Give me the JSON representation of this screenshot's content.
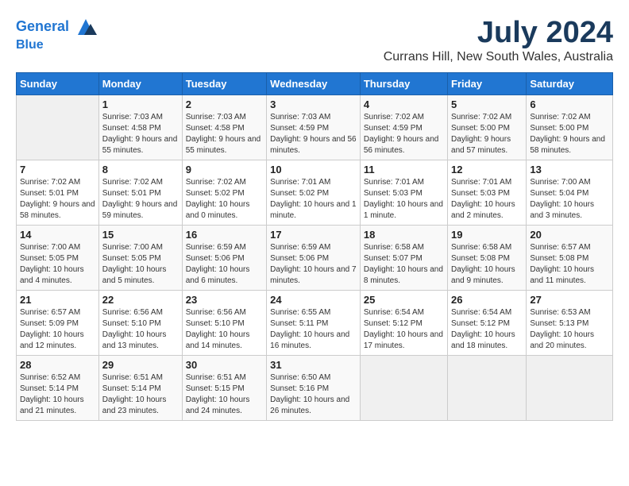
{
  "header": {
    "logo_line1": "General",
    "logo_line2": "Blue",
    "month_year": "July 2024",
    "location": "Currans Hill, New South Wales, Australia"
  },
  "days_of_week": [
    "Sunday",
    "Monday",
    "Tuesday",
    "Wednesday",
    "Thursday",
    "Friday",
    "Saturday"
  ],
  "weeks": [
    [
      {
        "day": "",
        "sunrise": "",
        "sunset": "",
        "daylight": ""
      },
      {
        "day": "1",
        "sunrise": "Sunrise: 7:03 AM",
        "sunset": "Sunset: 4:58 PM",
        "daylight": "Daylight: 9 hours and 55 minutes."
      },
      {
        "day": "2",
        "sunrise": "Sunrise: 7:03 AM",
        "sunset": "Sunset: 4:58 PM",
        "daylight": "Daylight: 9 hours and 55 minutes."
      },
      {
        "day": "3",
        "sunrise": "Sunrise: 7:03 AM",
        "sunset": "Sunset: 4:59 PM",
        "daylight": "Daylight: 9 hours and 56 minutes."
      },
      {
        "day": "4",
        "sunrise": "Sunrise: 7:02 AM",
        "sunset": "Sunset: 4:59 PM",
        "daylight": "Daylight: 9 hours and 56 minutes."
      },
      {
        "day": "5",
        "sunrise": "Sunrise: 7:02 AM",
        "sunset": "Sunset: 5:00 PM",
        "daylight": "Daylight: 9 hours and 57 minutes."
      },
      {
        "day": "6",
        "sunrise": "Sunrise: 7:02 AM",
        "sunset": "Sunset: 5:00 PM",
        "daylight": "Daylight: 9 hours and 58 minutes."
      }
    ],
    [
      {
        "day": "7",
        "sunrise": "Sunrise: 7:02 AM",
        "sunset": "Sunset: 5:01 PM",
        "daylight": "Daylight: 9 hours and 58 minutes."
      },
      {
        "day": "8",
        "sunrise": "Sunrise: 7:02 AM",
        "sunset": "Sunset: 5:01 PM",
        "daylight": "Daylight: 9 hours and 59 minutes."
      },
      {
        "day": "9",
        "sunrise": "Sunrise: 7:02 AM",
        "sunset": "Sunset: 5:02 PM",
        "daylight": "Daylight: 10 hours and 0 minutes."
      },
      {
        "day": "10",
        "sunrise": "Sunrise: 7:01 AM",
        "sunset": "Sunset: 5:02 PM",
        "daylight": "Daylight: 10 hours and 1 minute."
      },
      {
        "day": "11",
        "sunrise": "Sunrise: 7:01 AM",
        "sunset": "Sunset: 5:03 PM",
        "daylight": "Daylight: 10 hours and 1 minute."
      },
      {
        "day": "12",
        "sunrise": "Sunrise: 7:01 AM",
        "sunset": "Sunset: 5:03 PM",
        "daylight": "Daylight: 10 hours and 2 minutes."
      },
      {
        "day": "13",
        "sunrise": "Sunrise: 7:00 AM",
        "sunset": "Sunset: 5:04 PM",
        "daylight": "Daylight: 10 hours and 3 minutes."
      }
    ],
    [
      {
        "day": "14",
        "sunrise": "Sunrise: 7:00 AM",
        "sunset": "Sunset: 5:05 PM",
        "daylight": "Daylight: 10 hours and 4 minutes."
      },
      {
        "day": "15",
        "sunrise": "Sunrise: 7:00 AM",
        "sunset": "Sunset: 5:05 PM",
        "daylight": "Daylight: 10 hours and 5 minutes."
      },
      {
        "day": "16",
        "sunrise": "Sunrise: 6:59 AM",
        "sunset": "Sunset: 5:06 PM",
        "daylight": "Daylight: 10 hours and 6 minutes."
      },
      {
        "day": "17",
        "sunrise": "Sunrise: 6:59 AM",
        "sunset": "Sunset: 5:06 PM",
        "daylight": "Daylight: 10 hours and 7 minutes."
      },
      {
        "day": "18",
        "sunrise": "Sunrise: 6:58 AM",
        "sunset": "Sunset: 5:07 PM",
        "daylight": "Daylight: 10 hours and 8 minutes."
      },
      {
        "day": "19",
        "sunrise": "Sunrise: 6:58 AM",
        "sunset": "Sunset: 5:08 PM",
        "daylight": "Daylight: 10 hours and 9 minutes."
      },
      {
        "day": "20",
        "sunrise": "Sunrise: 6:57 AM",
        "sunset": "Sunset: 5:08 PM",
        "daylight": "Daylight: 10 hours and 11 minutes."
      }
    ],
    [
      {
        "day": "21",
        "sunrise": "Sunrise: 6:57 AM",
        "sunset": "Sunset: 5:09 PM",
        "daylight": "Daylight: 10 hours and 12 minutes."
      },
      {
        "day": "22",
        "sunrise": "Sunrise: 6:56 AM",
        "sunset": "Sunset: 5:10 PM",
        "daylight": "Daylight: 10 hours and 13 minutes."
      },
      {
        "day": "23",
        "sunrise": "Sunrise: 6:56 AM",
        "sunset": "Sunset: 5:10 PM",
        "daylight": "Daylight: 10 hours and 14 minutes."
      },
      {
        "day": "24",
        "sunrise": "Sunrise: 6:55 AM",
        "sunset": "Sunset: 5:11 PM",
        "daylight": "Daylight: 10 hours and 16 minutes."
      },
      {
        "day": "25",
        "sunrise": "Sunrise: 6:54 AM",
        "sunset": "Sunset: 5:12 PM",
        "daylight": "Daylight: 10 hours and 17 minutes."
      },
      {
        "day": "26",
        "sunrise": "Sunrise: 6:54 AM",
        "sunset": "Sunset: 5:12 PM",
        "daylight": "Daylight: 10 hours and 18 minutes."
      },
      {
        "day": "27",
        "sunrise": "Sunrise: 6:53 AM",
        "sunset": "Sunset: 5:13 PM",
        "daylight": "Daylight: 10 hours and 20 minutes."
      }
    ],
    [
      {
        "day": "28",
        "sunrise": "Sunrise: 6:52 AM",
        "sunset": "Sunset: 5:14 PM",
        "daylight": "Daylight: 10 hours and 21 minutes."
      },
      {
        "day": "29",
        "sunrise": "Sunrise: 6:51 AM",
        "sunset": "Sunset: 5:14 PM",
        "daylight": "Daylight: 10 hours and 23 minutes."
      },
      {
        "day": "30",
        "sunrise": "Sunrise: 6:51 AM",
        "sunset": "Sunset: 5:15 PM",
        "daylight": "Daylight: 10 hours and 24 minutes."
      },
      {
        "day": "31",
        "sunrise": "Sunrise: 6:50 AM",
        "sunset": "Sunset: 5:16 PM",
        "daylight": "Daylight: 10 hours and 26 minutes."
      },
      {
        "day": "",
        "sunrise": "",
        "sunset": "",
        "daylight": ""
      },
      {
        "day": "",
        "sunrise": "",
        "sunset": "",
        "daylight": ""
      },
      {
        "day": "",
        "sunrise": "",
        "sunset": "",
        "daylight": ""
      }
    ]
  ]
}
